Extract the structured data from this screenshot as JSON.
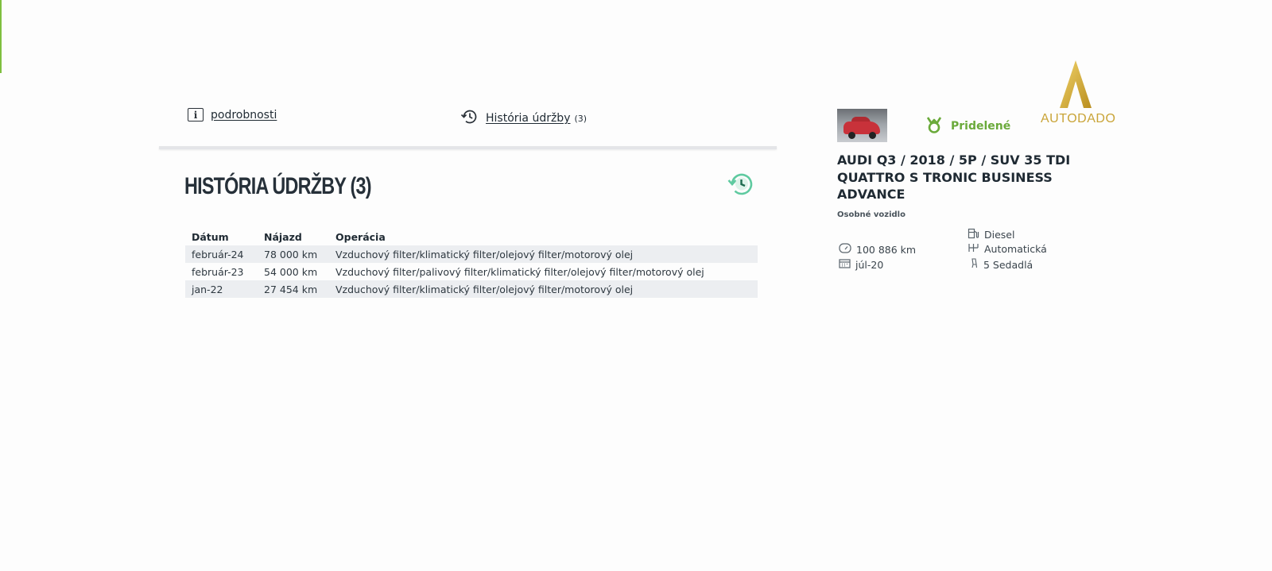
{
  "tabs": {
    "details_label": "podrobnosti",
    "history_label": "História údržby",
    "history_count": "(3)"
  },
  "section": {
    "title": "HISTÓRIA ÚDRŽBY (3)"
  },
  "table": {
    "headers": [
      "Dátum",
      "Nájazd",
      "Operácia"
    ],
    "rows": [
      [
        "február-24",
        "78 000 km",
        "Vzduchový filter/klimatický filter/olejový filter/motorový olej"
      ],
      [
        "február-23",
        "54 000 km",
        "Vzduchový filter/palivový filter/klimatický filter/olejový filter/motorový olej"
      ],
      [
        "jan-22",
        "27 454 km",
        "Vzduchový filter/klimatický filter/olejový filter/motorový olej"
      ]
    ]
  },
  "card": {
    "assigned_label": "Pridelené",
    "logo_text": "AUTODADO",
    "title": "AUDI Q3 / 2018 / 5P / SUV 35 TDI QUATTRO S TRONIC BUSINESS ADVANCE",
    "vehicle_type": "Osobné vozidlo",
    "specs": {
      "fuel": "Diesel",
      "mileage": "100 886 km",
      "transmission": "Automatická",
      "date": "júl-20",
      "seats": "5 Sedadlá"
    }
  },
  "colors": {
    "accent_green": "#6aaa3a",
    "history_icon": "#5fcaa0",
    "logo_gold": "#c9a437"
  },
  "icons": {
    "details": "info-icon",
    "history": "history-icon",
    "badge": "history-badge-icon",
    "assigned": "ribbon-award-icon",
    "fuel": "fuel-pump-icon",
    "mileage": "speedometer-icon",
    "transmission": "gearbox-icon",
    "date": "calendar-icon",
    "seats": "seat-icon"
  }
}
